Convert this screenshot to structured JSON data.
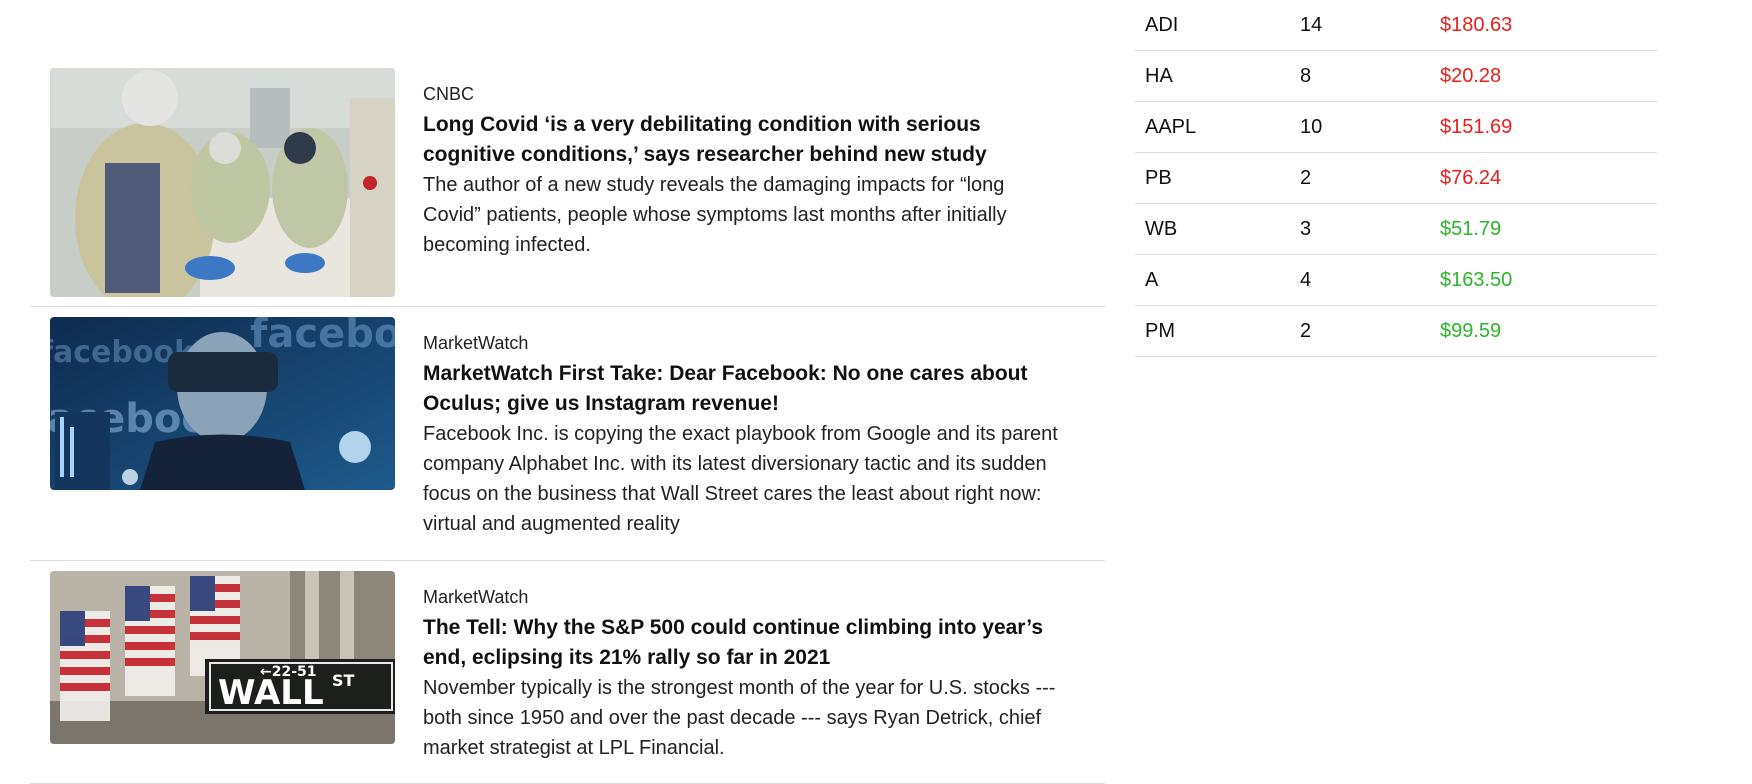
{
  "news": [
    {
      "source": "CNBC",
      "title": "Long Covid ‘is a very debilitating condition with serious cognitive conditions,’ says researcher behind new study",
      "summary": "The author of a new study reveals the damaging impacts for “long Covid” patients, people whose symptoms last months after initially becoming infected."
    },
    {
      "source": "MarketWatch",
      "title": "MarketWatch First Take: Dear Facebook: No one cares about Oculus; give us Instagram revenue!",
      "summary": "Facebook Inc. is copying the exact playbook from Google and its parent company Alphabet Inc. with its latest diversionary tactic and its sudden focus on the business that Wall Street cares the least about right now: virtual and augmented reality",
      "image_text": "facebook"
    },
    {
      "source": "MarketWatch",
      "title": "The Tell: Why the S&P 500 could continue climbing into year’s end, eclipsing its 21% rally so far in 2021",
      "summary": "November typically is the strongest month of the year for U.S. stocks --- both since 1950 and over the past decade --- says Ryan Detrick, chief market strategist at LPL Financial.",
      "image_sign_main": "WALL",
      "image_sign_suffix": "ST",
      "image_sign_number": "←22-51"
    }
  ],
  "holdings": [
    {
      "symbol": "ADI",
      "qty": "14",
      "price": "$180.63",
      "trend": "down"
    },
    {
      "symbol": "HA",
      "qty": "8",
      "price": "$20.28",
      "trend": "down"
    },
    {
      "symbol": "AAPL",
      "qty": "10",
      "price": "$151.69",
      "trend": "down"
    },
    {
      "symbol": "PB",
      "qty": "2",
      "price": "$76.24",
      "trend": "down"
    },
    {
      "symbol": "WB",
      "qty": "3",
      "price": "$51.79",
      "trend": "up"
    },
    {
      "symbol": "A",
      "qty": "4",
      "price": "$163.50",
      "trend": "up"
    },
    {
      "symbol": "PM",
      "qty": "2",
      "price": "$99.59",
      "trend": "up"
    }
  ],
  "colors": {
    "down": "#e8201a",
    "up": "#2bb52b"
  }
}
